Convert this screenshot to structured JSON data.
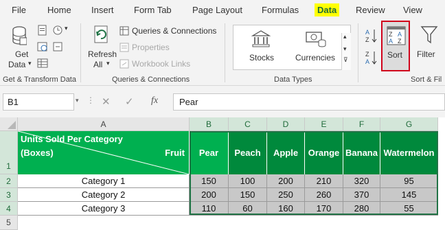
{
  "menu": {
    "items": [
      "File",
      "Home",
      "Insert",
      "Form Tab",
      "Page Layout",
      "Formulas",
      "Data",
      "Review",
      "View"
    ],
    "active": "Data",
    "active_color": "#ffff00"
  },
  "ribbon": {
    "get_transform": {
      "get_data_line1": "Get",
      "get_data_line2": "Data",
      "label": "Get & Transform Data"
    },
    "queries": {
      "refresh_line1": "Refresh",
      "refresh_line2": "All",
      "queries_connections": "Queries & Connections",
      "properties": "Properties",
      "workbook_links": "Workbook Links",
      "label": "Queries & Connections"
    },
    "data_types": {
      "stocks": "Stocks",
      "currencies": "Currencies",
      "label": "Data Types"
    },
    "sort_filter": {
      "sort": "Sort",
      "filter": "Filter",
      "label": "Sort & Fil",
      "sort_highlight_color": "#d0021b"
    }
  },
  "formula_bar": {
    "name_box": "B1",
    "fx": "fx",
    "value": "Pear"
  },
  "grid": {
    "columns": [
      "A",
      "B",
      "C",
      "D",
      "E",
      "F",
      "G"
    ],
    "rows": [
      "1",
      "2",
      "3",
      "4",
      "5"
    ],
    "header_text_line1": "Units Sold Per Category",
    "header_text_line2": "(Boxes)",
    "header_fruit": "Fruit",
    "fruits": [
      "Pear",
      "Peach",
      "Apple",
      "Orange",
      "Banana",
      "Watermelon"
    ],
    "categories": [
      "Category 1",
      "Category 2",
      "Category 3"
    ],
    "values": [
      [
        150,
        100,
        200,
        210,
        320,
        95
      ],
      [
        200,
        150,
        250,
        260,
        370,
        145
      ],
      [
        110,
        60,
        160,
        170,
        280,
        55
      ]
    ],
    "header_green": "#00b050",
    "header_green_dark": "#00893c"
  }
}
